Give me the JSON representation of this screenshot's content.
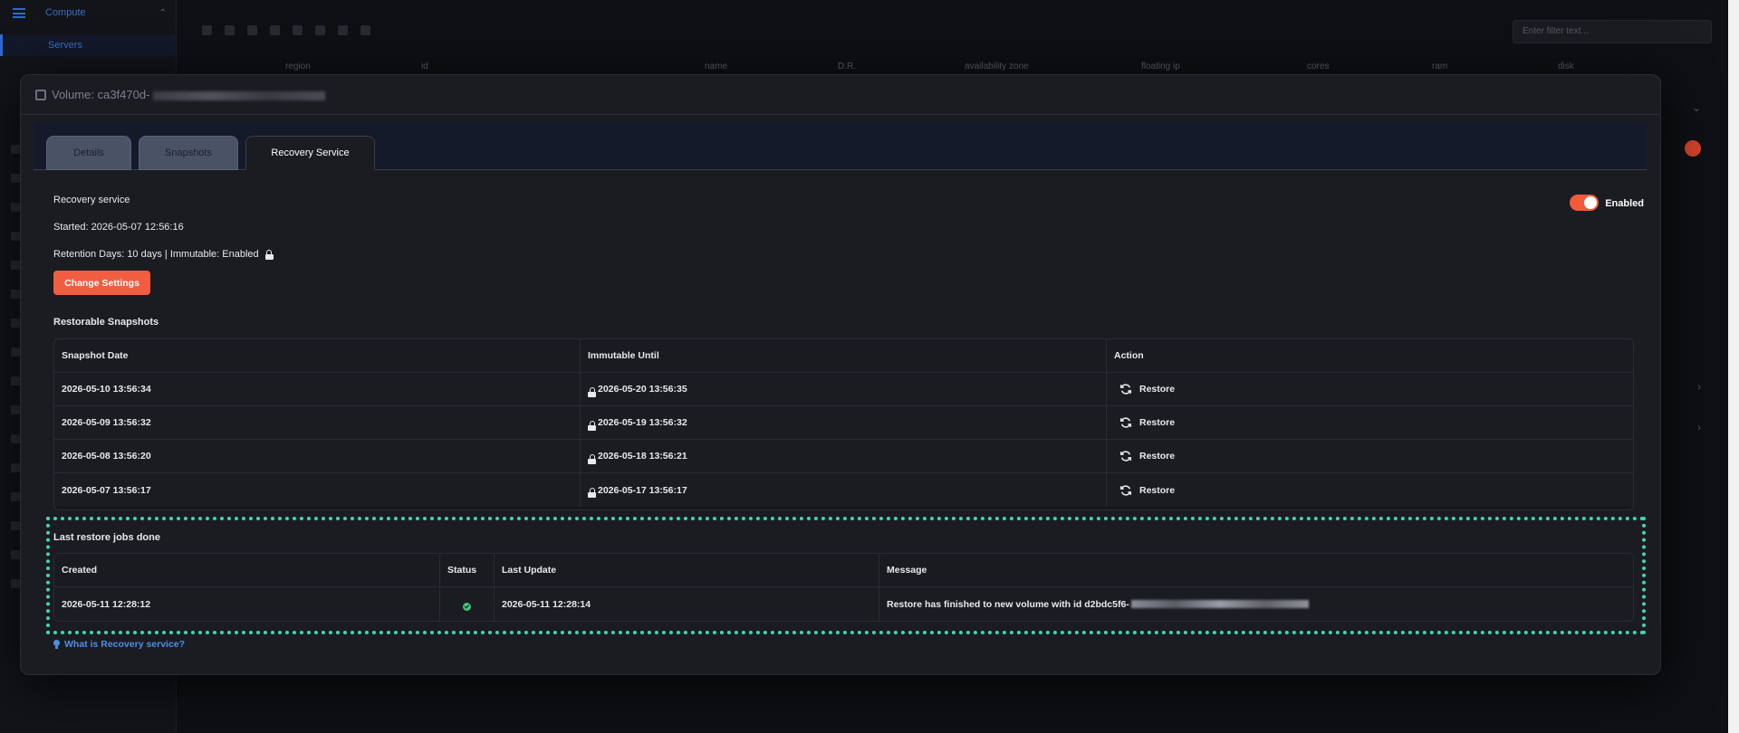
{
  "background": {
    "sidebar_group": "Compute",
    "sidebar_sub": "Servers",
    "filter_placeholder": "Enter filter text...",
    "columns": [
      "region",
      "id",
      "name",
      "D.R.",
      "availability zone",
      "floating ip",
      "cores",
      "ram",
      "disk"
    ]
  },
  "modal": {
    "title_prefix": "Volume: ca3f470d-",
    "tabs": [
      "Details",
      "Snapshots",
      "Recovery Service"
    ],
    "active_tab": "Recovery Service",
    "recovery_title": "Recovery service",
    "toggle_label": "Enabled",
    "started": "Started: 2026-05-07 12:56:16",
    "retention": "Retention Days: 10 days | Immutable: Enabled",
    "change_settings": "Change Settings",
    "snapshots_title": "Restorable Snapshots",
    "snapshot_columns": [
      "Snapshot Date",
      "Immutable Until",
      "Action"
    ],
    "snapshots": [
      {
        "date": "2026-05-10 13:56:34",
        "until": "2026-05-20 13:56:35",
        "action": "Restore"
      },
      {
        "date": "2026-05-09 13:56:32",
        "until": "2026-05-19 13:56:32",
        "action": "Restore"
      },
      {
        "date": "2026-05-08 13:56:20",
        "until": "2026-05-18 13:56:21",
        "action": "Restore"
      },
      {
        "date": "2026-05-07 13:56:17",
        "until": "2026-05-17 13:56:17",
        "action": "Restore"
      }
    ],
    "jobs_title": "Last restore jobs done",
    "job_columns": [
      "Created",
      "Status",
      "Last Update",
      "Message"
    ],
    "jobs": [
      {
        "created": "2026-05-11 12:28:12",
        "status": "success",
        "updated": "2026-05-11 12:28:14",
        "message": "Restore has finished to new volume with id d2bdc5f6-"
      }
    ],
    "help_link": "What is Recovery service?"
  },
  "colors": {
    "accent_orange": "#f05d40",
    "link_blue": "#4c8fe6",
    "highlight_teal": "#3fd6b0",
    "success_green": "#43c47a"
  }
}
